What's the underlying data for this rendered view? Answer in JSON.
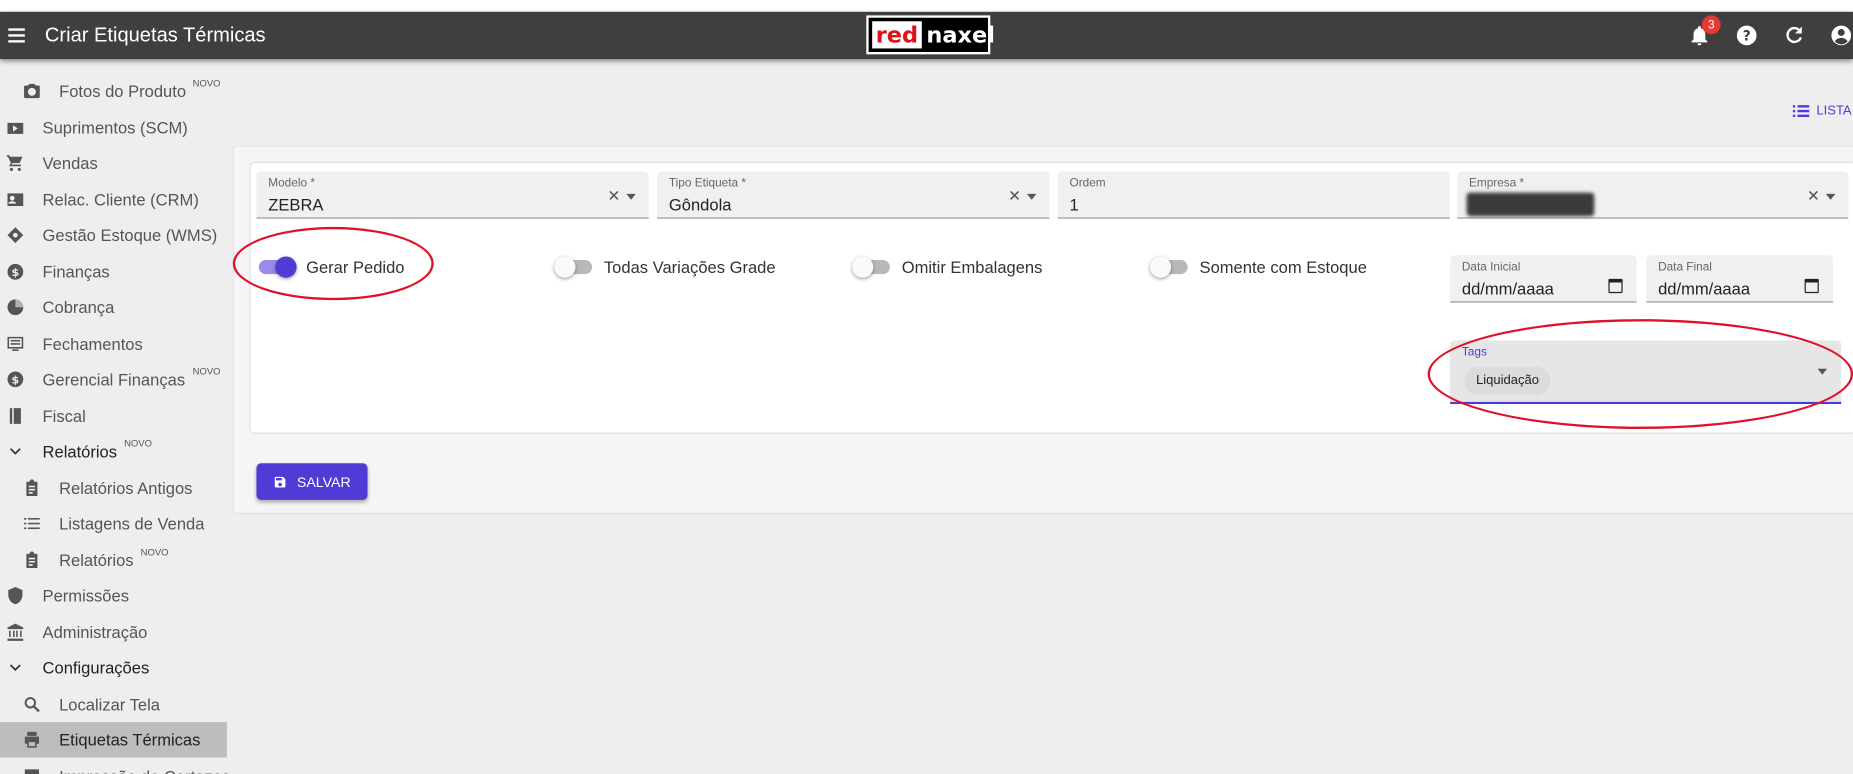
{
  "appbar": {
    "title": "Criar Etiquetas Térmicas",
    "logo_left": "red",
    "logo_right": "naxel",
    "notifications_count": "3",
    "icons": [
      "menu-icon",
      "bell-icon",
      "help-icon",
      "refresh-icon",
      "account-icon"
    ]
  },
  "sidebar": {
    "novo": "NOVO",
    "items": [
      {
        "label": "Fotos do Produto",
        "icon": "camera-icon",
        "novo": true
      },
      {
        "label": "Suprimentos (SCM)",
        "icon": "supply-icon"
      },
      {
        "label": "Vendas",
        "icon": "cart-icon"
      },
      {
        "label": "Relac. Cliente (CRM)",
        "icon": "contact-card-icon"
      },
      {
        "label": "Gestão Estoque (WMS)",
        "icon": "warehouse-icon"
      },
      {
        "label": "Finanças",
        "icon": "dollar-icon"
      },
      {
        "label": "Cobrança",
        "icon": "pie-icon"
      },
      {
        "label": "Fechamentos",
        "icon": "receipt-icon"
      },
      {
        "label": "Gerencial Finanças",
        "icon": "dollar-icon",
        "novo": true
      },
      {
        "label": "Fiscal",
        "icon": "book-icon"
      },
      {
        "label": "Relatórios",
        "icon": "chevron-down-icon",
        "novo": true
      },
      {
        "label": "Relatórios Antigos",
        "icon": "clipboard-icon"
      },
      {
        "label": "Listagens de Venda",
        "icon": "list-icon"
      },
      {
        "label": "Relatórios",
        "icon": "clipboard-icon",
        "novo": true
      },
      {
        "label": "Permissões",
        "icon": "shield-icon"
      },
      {
        "label": "Administração",
        "icon": "bank-icon"
      },
      {
        "label": "Configurações",
        "icon": "chevron-down-icon"
      },
      {
        "label": "Localizar Tela",
        "icon": "search-icon"
      },
      {
        "label": "Etiquetas Térmicas",
        "icon": "printer-icon"
      },
      {
        "label": "Impressão de Cartazes",
        "icon": "poster-icon"
      }
    ]
  },
  "header_actions": {
    "list_label": "LISTA"
  },
  "form": {
    "modelo": {
      "label": "Modelo *",
      "value": "ZEBRA"
    },
    "tipo": {
      "label": "Tipo Etiqueta *",
      "value": "Gôndola"
    },
    "ordem": {
      "label": "Ordem",
      "value": "1"
    },
    "empresa": {
      "label": "Empresa *",
      "value": ""
    },
    "toggles": [
      {
        "label": "Gerar Pedido",
        "checked": true
      },
      {
        "label": "Todas Variações Grade",
        "checked": false
      },
      {
        "label": "Omitir Embalagens",
        "checked": false
      },
      {
        "label": "Somente com Estoque",
        "checked": false
      }
    ],
    "data_inicial": {
      "label": "Data Inicial",
      "placeholder": "dd/mm/aaaa"
    },
    "data_final": {
      "label": "Data Final",
      "placeholder": "dd/mm/aaaa"
    },
    "tags": {
      "label": "Tags",
      "chips": [
        "Liquidação"
      ]
    },
    "save_label": "SALVAR"
  },
  "colors": {
    "primary": "#4f3bd6",
    "appbar": "#3f3f3f",
    "highlight": "#e0102a",
    "badge": "#e53935"
  }
}
